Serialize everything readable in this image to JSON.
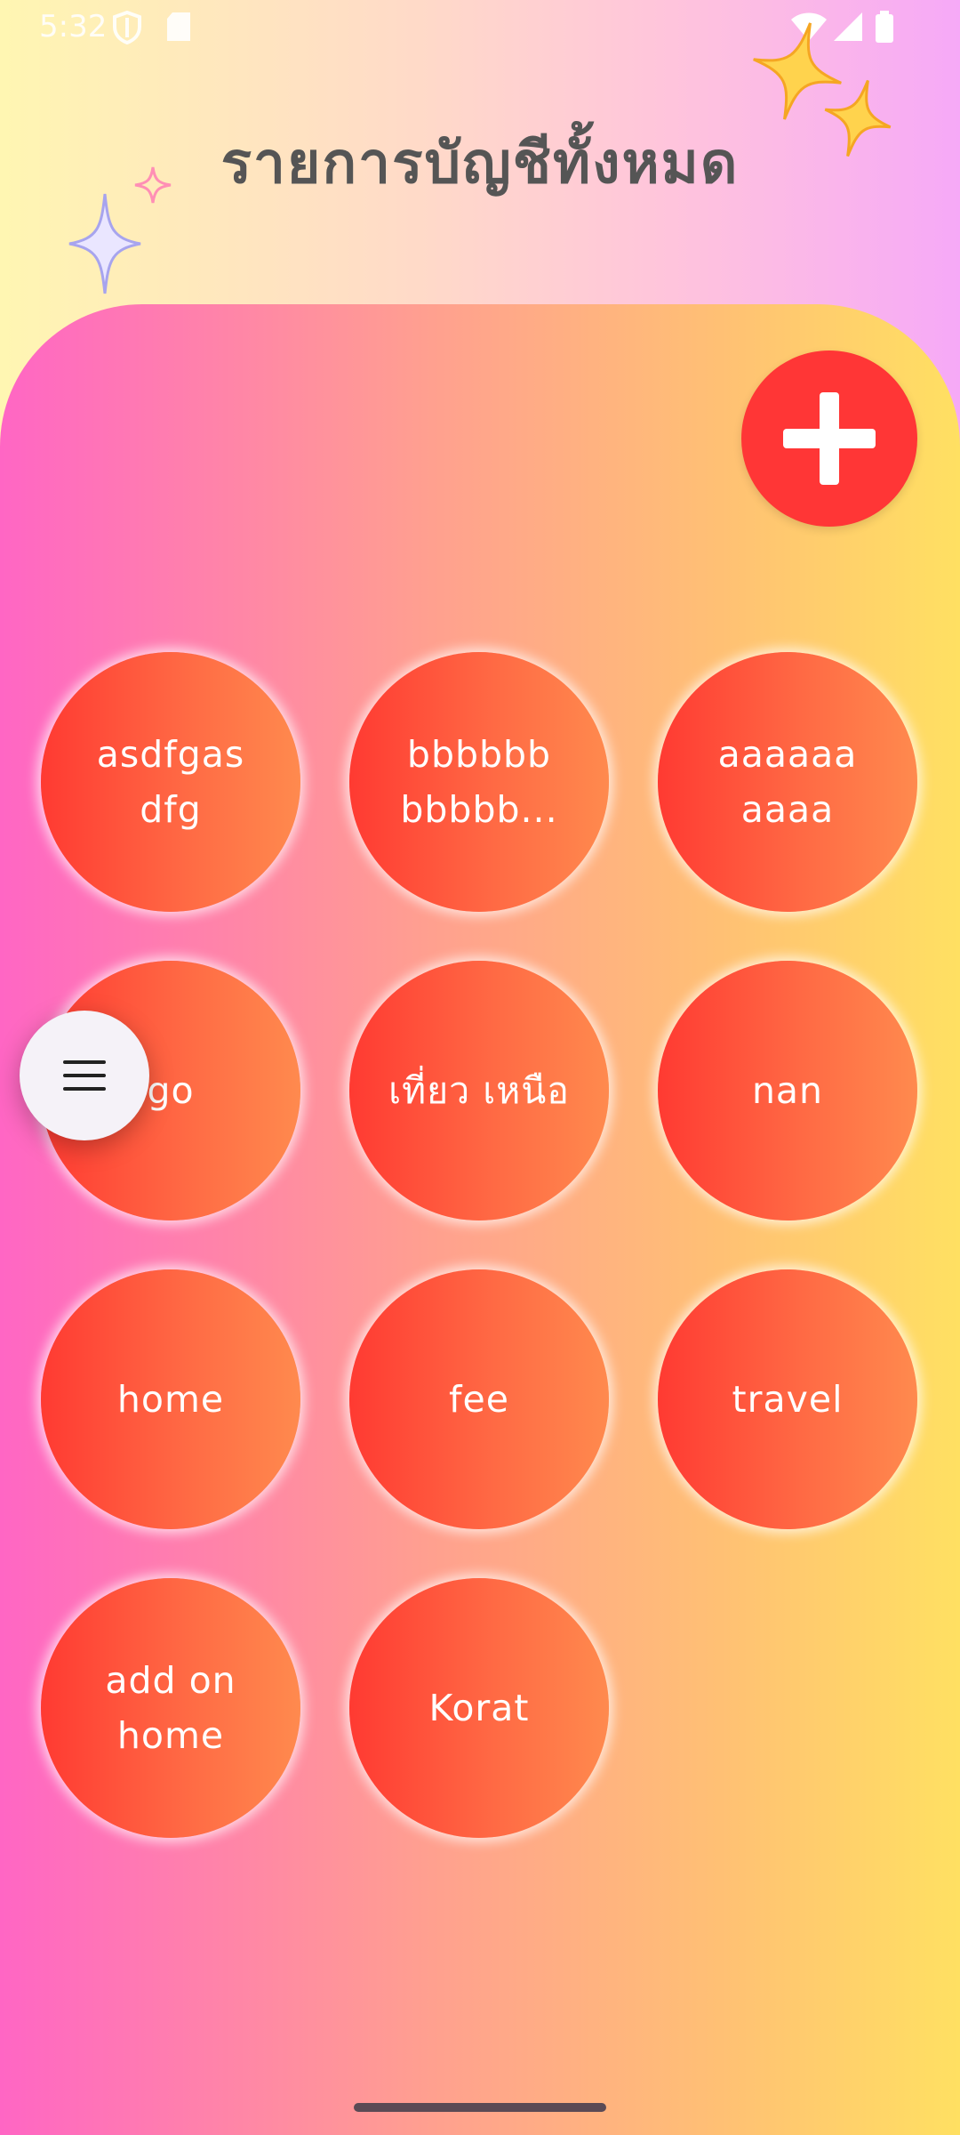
{
  "status_bar": {
    "time": "5:32",
    "icons": [
      "shield-icon",
      "sd-card-icon",
      "wifi-icon",
      "signal-icon",
      "battery-icon"
    ]
  },
  "header": {
    "title": "รายการบัญชีทั้งหมด"
  },
  "actions": {
    "add_icon": "plus-icon",
    "menu_icon": "hamburger-menu-icon"
  },
  "accounts": [
    {
      "label": "asdfgas dfg"
    },
    {
      "label": "bbbbbb bbbbb..."
    },
    {
      "label": "aaaaaa aaaa"
    },
    {
      "label": "go"
    },
    {
      "label": "เที่ยว เหนือ"
    },
    {
      "label": "nan"
    },
    {
      "label": "home"
    },
    {
      "label": "fee"
    },
    {
      "label": "travel"
    },
    {
      "label": "add on home"
    },
    {
      "label": "Korat"
    }
  ],
  "colors": {
    "add_button": "#ff3636",
    "account_circle_start": "#ff3a32",
    "account_circle_end": "#ff8a4e",
    "title_text": "#555555",
    "panel_left": "#ff66c4",
    "panel_right": "#ffe062"
  }
}
